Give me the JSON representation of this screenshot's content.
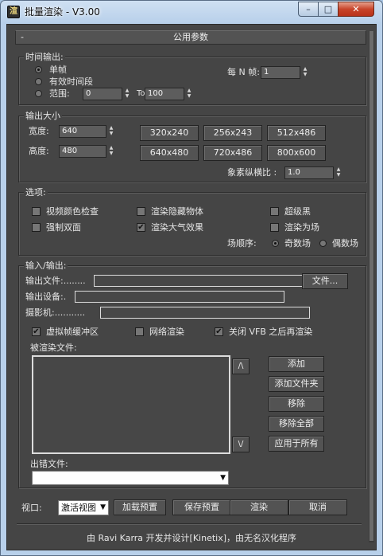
{
  "window": {
    "title": "批量渲染 - V3.00",
    "icon": "app-icon",
    "min_glyph": "–",
    "max_glyph": "□",
    "close_glyph": "✕"
  },
  "rollout": {
    "collapse_glyph": "-",
    "title": "公用参数"
  },
  "time_output": {
    "group_title": "时间输出:",
    "single_frame": "单帧",
    "active_segment": "有效时间段",
    "range_label": "范围:",
    "range_start": "0",
    "to_label": "To",
    "range_end": "100",
    "every_nth_label": "每 N 帧:",
    "every_nth_value": "1",
    "selected": "single_frame"
  },
  "output_size": {
    "group_title": "输出大小",
    "width_label": "宽度:",
    "width_value": "640",
    "height_label": "高度:",
    "height_value": "480",
    "presets": [
      "320x240",
      "256x243",
      "512x486",
      "640x480",
      "720x486",
      "800x600"
    ],
    "pixel_aspect_label": "象素纵横比 :",
    "pixel_aspect_value": "1.0"
  },
  "options": {
    "group_title": "选项:",
    "video_color_check": {
      "label": "视频颜色检查",
      "checked": false
    },
    "render_hidden": {
      "label": "渲染隐藏物体",
      "checked": false
    },
    "super_black": {
      "label": "超级黑",
      "checked": false
    },
    "force_two_sided": {
      "label": "强制双面",
      "checked": false
    },
    "render_atmospherics": {
      "label": "渲染大气效果",
      "checked": true
    },
    "render_to_fields": {
      "label": "渲染为场",
      "checked": false
    },
    "field_order_label": "场顺序:",
    "odd_field": "奇数场",
    "even_field": "偶数场",
    "field_selected": "odd"
  },
  "io": {
    "group_title": "输入/输出:",
    "output_file_label": "输出文件:........",
    "output_file_value": "",
    "file_button": "文件...",
    "output_device_label": "输出设备:.",
    "output_device_value": "",
    "camera_label": "摄影机:...........",
    "camera_value": "",
    "virtual_frame_buffer": {
      "label": "虚拟帧缓冲区",
      "checked": true
    },
    "net_render": {
      "label": "网络渲染",
      "checked": false
    },
    "close_vfb": {
      "label": "关闭 VFB 之后再渲染",
      "checked": true
    },
    "render_files_label": "被渲染文件:",
    "move_up": "/\\",
    "move_down": "\\/",
    "add": "添加",
    "add_folder": "添加文件夹",
    "remove": "移除",
    "remove_all": "移除全部",
    "apply_all": "应用于所有",
    "error_file_label": "出错文件:",
    "error_file_value": ""
  },
  "bottom": {
    "viewport_label": "视口:",
    "viewport_value": "激活视图",
    "load_preset": "加载预置",
    "save_preset": "保存预置",
    "render": "渲染",
    "cancel": "取消"
  },
  "footer": "由 Ravi Karra 开发并设计[Kinetix]，由无名汉化程序"
}
